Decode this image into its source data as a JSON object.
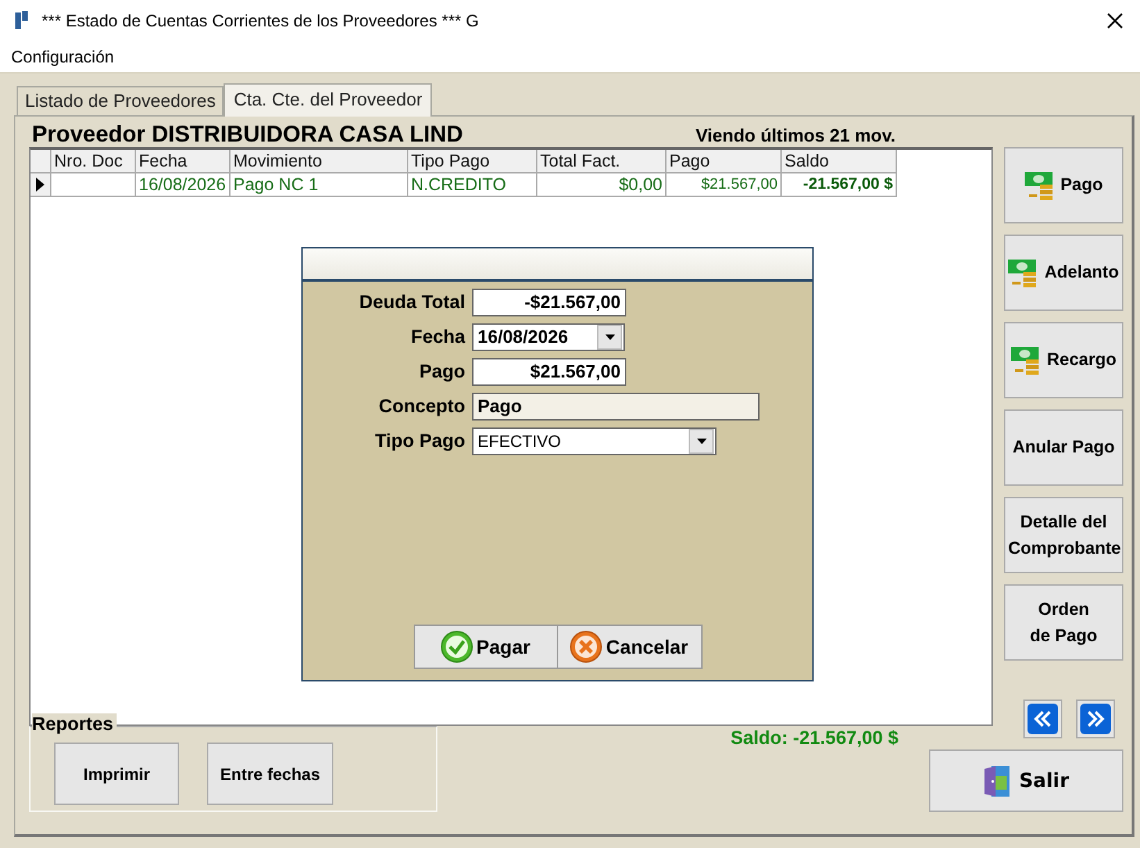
{
  "window": {
    "title": "*** Estado de Cuentas Corrientes de los Proveedores *** G"
  },
  "menu": [
    "Configuración"
  ],
  "tabs": [
    {
      "label": "Listado de Proveedores",
      "selected": false
    },
    {
      "label": "Cta. Cte. del Proveedor",
      "selected": true
    }
  ],
  "header": {
    "proveedor": "Proveedor DISTRIBUIDORA CASA LIND",
    "viendo": "Viendo últimos 21 mov."
  },
  "table": {
    "columns": [
      "Nro. Doc",
      "Fecha",
      "Movimiento",
      "Tipo Pago",
      "Total Fact.",
      "Pago",
      "Saldo"
    ],
    "rows": [
      {
        "current": true,
        "cells": [
          "",
          "16/08/2026",
          "Pago NC 1",
          "N.CREDITO",
          "$0,00",
          "$21.567,00",
          "-21.567,00 $"
        ]
      }
    ]
  },
  "dialog": {
    "fields": [
      {
        "kind": "text",
        "label": "Deuda Total",
        "value": "-$21.567,00"
      },
      {
        "kind": "date",
        "label": "Fecha",
        "value": "16/08/2026"
      },
      {
        "kind": "text",
        "label": "Pago",
        "value": "$21.567,00"
      },
      {
        "kind": "readonly",
        "label": "Concepto",
        "value": "Pago"
      },
      {
        "kind": "select",
        "label": "Tipo Pago",
        "value": "EFECTIVO"
      }
    ],
    "buttons": [
      {
        "kind": "ok",
        "label": "Pagar"
      },
      {
        "kind": "cancel",
        "label": "Cancelar"
      }
    ]
  },
  "side_buttons": [
    {
      "kind": "money",
      "label": "Pago"
    },
    {
      "kind": "money",
      "label": "Adelanto"
    },
    {
      "kind": "money",
      "label": "Recargo"
    },
    {
      "kind": "plain",
      "label": "Anular Pago"
    },
    {
      "kind": "plain",
      "label": "Detalle del Comprobante"
    },
    {
      "kind": "plain",
      "label": "Orden de Pago"
    }
  ],
  "reportes": {
    "title": "Reportes",
    "buttons": [
      "Imprimir",
      "Entre fechas"
    ]
  },
  "saldo": "Saldo: -21.567,00 $",
  "salir": "Salir"
}
